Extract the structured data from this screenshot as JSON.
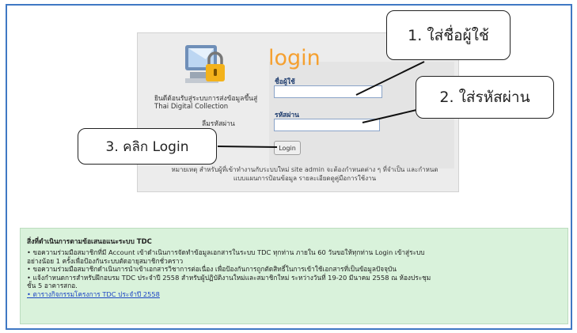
{
  "login": {
    "title": "login",
    "welcome_text": "ยินดีต้อนรับสู่ระบบการส่งข้อมูลขึ้นสู่ Thai Digital Collection",
    "forgot_text": "ลืมรหัสผ่าน",
    "username_label": "ชื่อผู้ใช้",
    "username_value": "",
    "password_label": "รหัสผ่าน",
    "password_value": "",
    "login_button": "Login",
    "info_line1": "หมายเหตุ สำหรับผู้ที่เข้าทำงานกับระบบใหม่ site admin จะต้องกำหนดต่าง ๆ ที่จำเป็น และกำหนด",
    "info_line2": "แบบแผนการป้อนข้อมูล รายละเอียดดูคู่มือการใช้งาน"
  },
  "callouts": {
    "step1": "1. ใส่ชื่อผู้ใช้",
    "step2": "2. ใส่รหัสผ่าน",
    "step3": "3. คลิก Login"
  },
  "notice": {
    "title": "สิ่งที่ดำเนินการตามข้อเสนอแนะระบบ TDC",
    "lines": [
      "• ขอความร่วมมือสมาชิกที่มี Account เข้าดำเนินการจัดทำข้อมูลเอกสารในระบบ TDC ทุกท่าน ภายใน 60 วันขอให้ทุกท่าน Login เข้าสู่ระบบ",
      "อย่างน้อย 1 ครั้งเพื่อป้องกันระบบตัดอายุสมาชิกชั่วคราว",
      "• ขอความร่วมมือสมาชิกดำเนินการนำเข้าเอกสารวิชาการต่อเนื่อง เพื่อป้องกันการถูกตัดสิทธิ์ในการเข้าใช้เอกสารที่เป็นข้อมูลปัจจุบัน",
      "• แจ้งกำหนดการสำหรับฝึกอบรม TDC ประจำปี 2558 สำหรับผู้ปฏิบัติงานใหม่และสมาชิกใหม่ ระหว่างวันที่ 19-20 มีนาคม 2558 ณ ห้องประชุม",
      "ชั้น 5 อาคารสกอ."
    ],
    "link": "• ตารางกิจกรรมโครงการ TDC ประจำปี 2558"
  },
  "colors": {
    "frame": "#3f78c4",
    "login_title": "#f5a030",
    "notice_bg": "#d9f2db",
    "link": "#1a44c4"
  },
  "icons": [
    "computer-lock-icon"
  ]
}
